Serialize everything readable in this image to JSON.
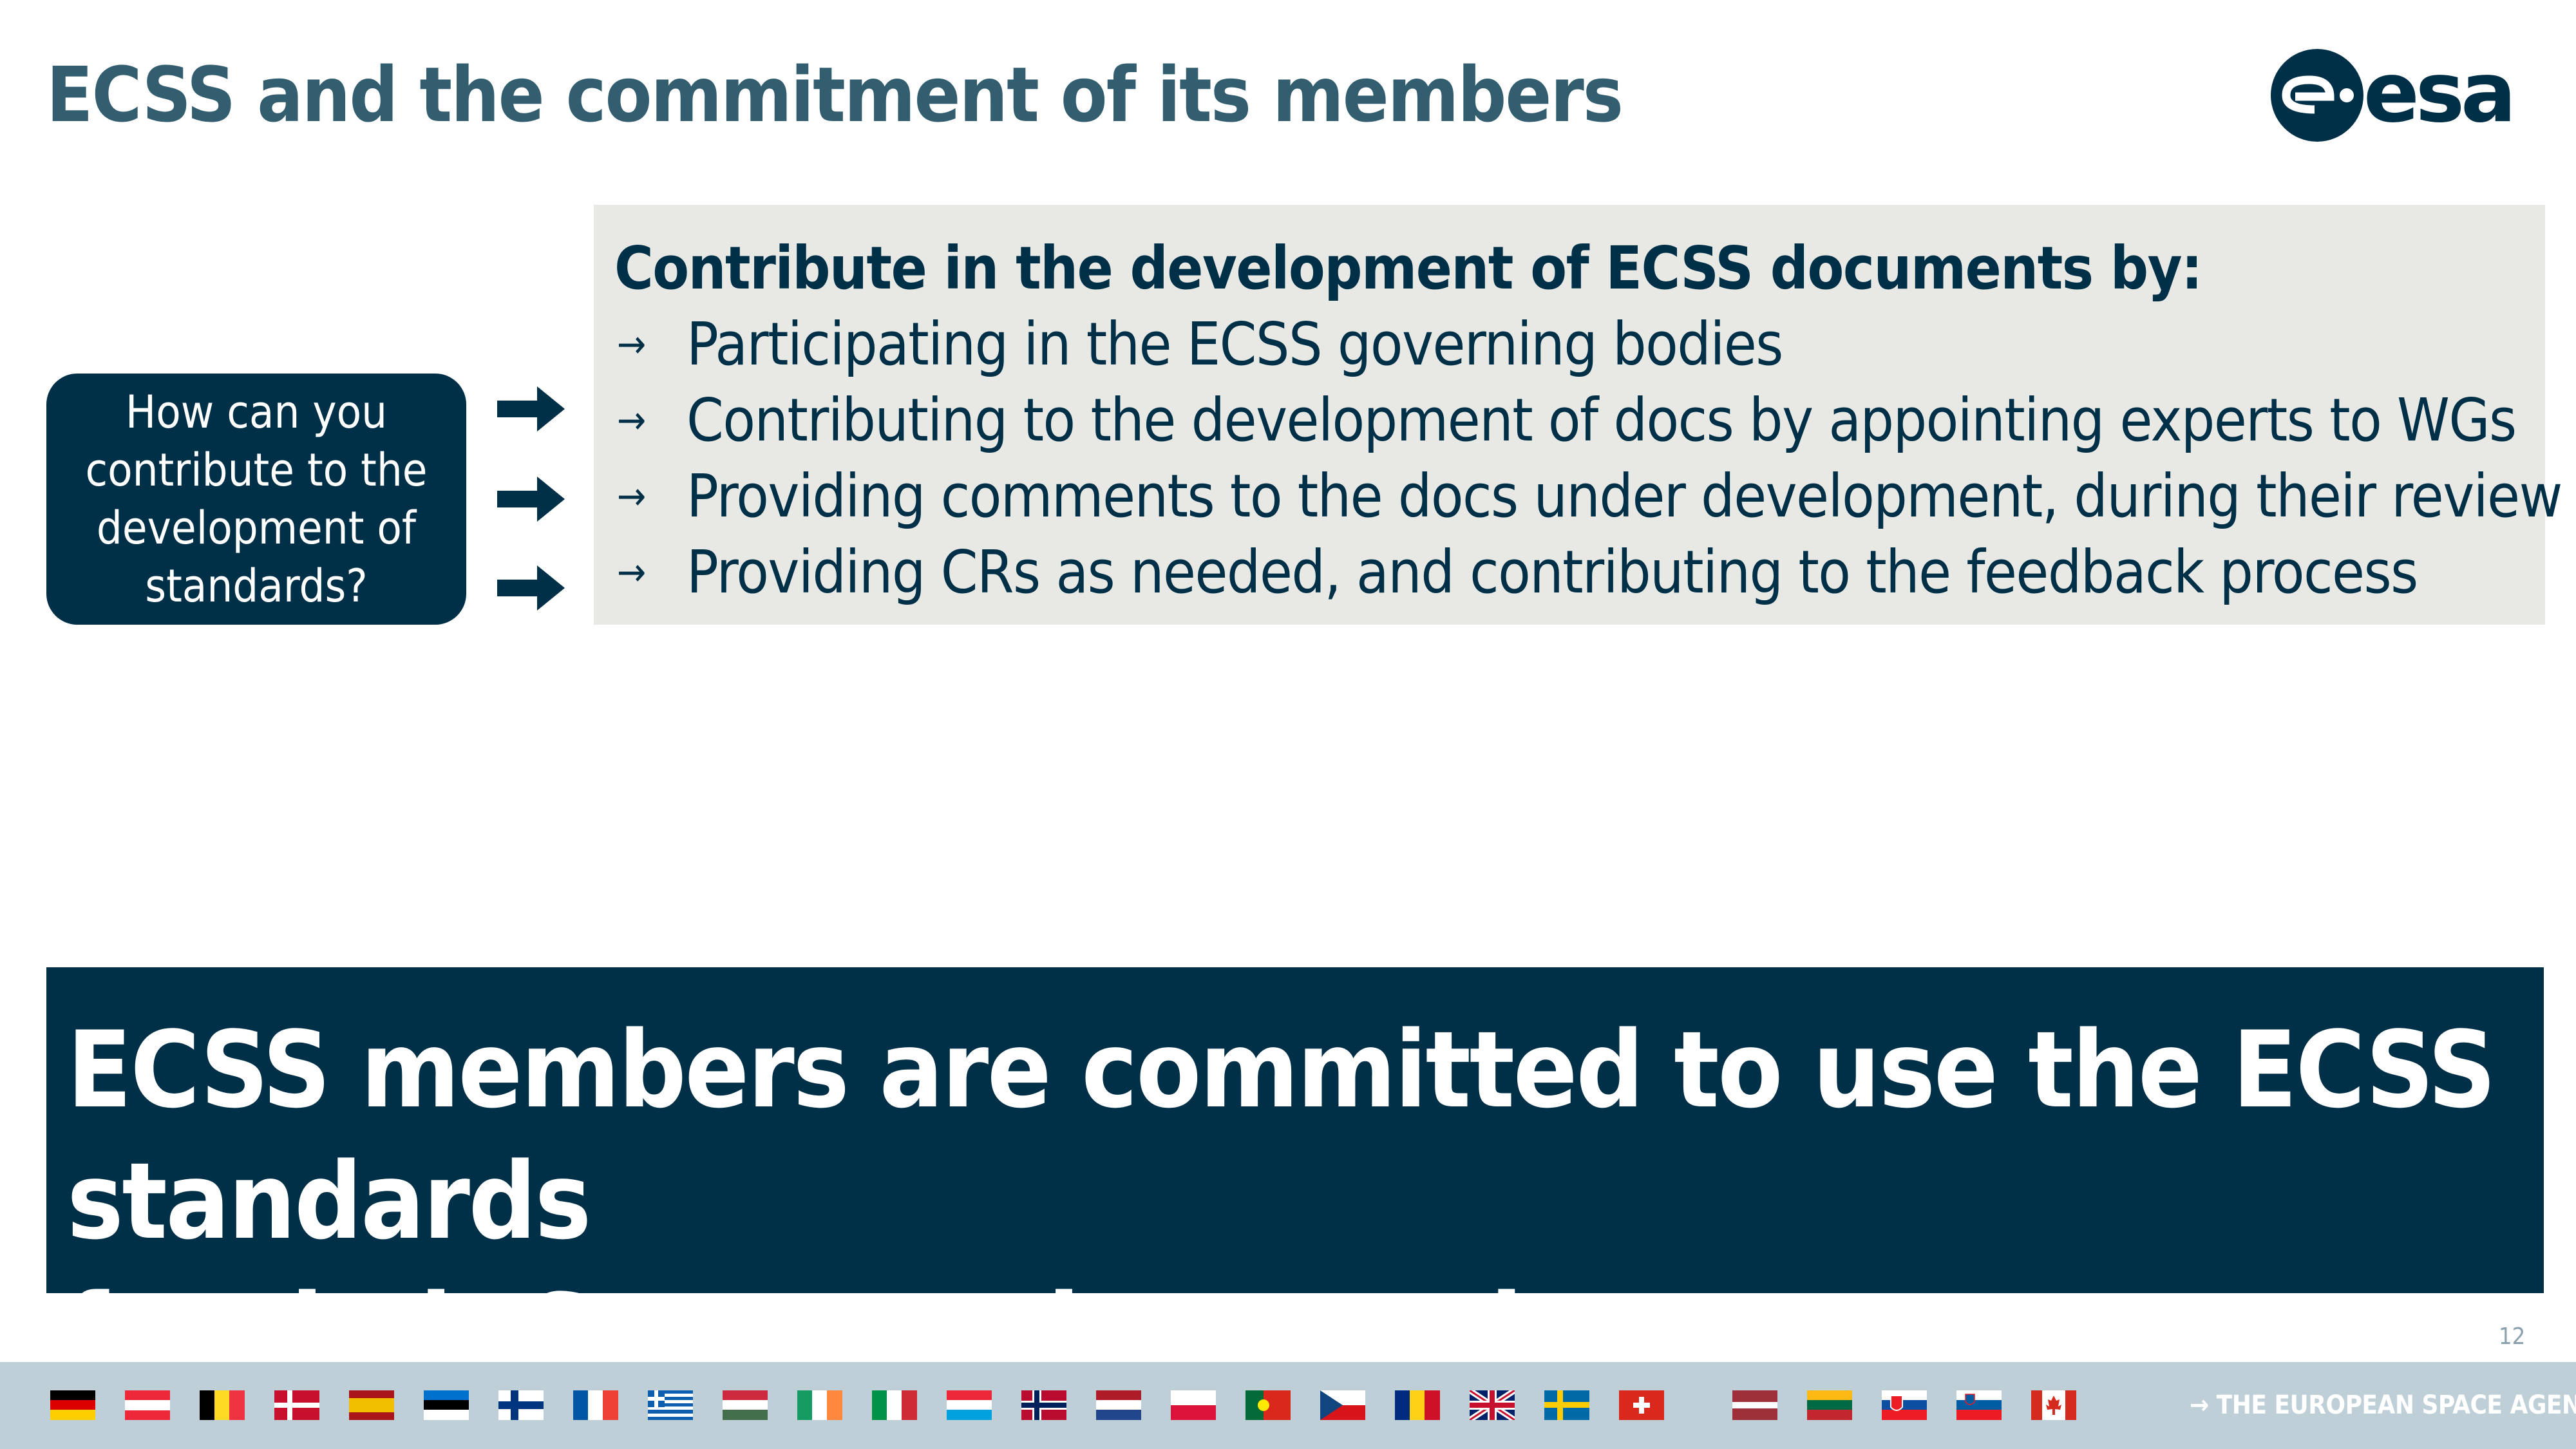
{
  "slide": {
    "title": "ECSS and the commitment of its members",
    "page_number": "12"
  },
  "logo": {
    "text": "esa"
  },
  "question": {
    "text": "How can you contribute to the development of standards?"
  },
  "info_panel": {
    "heading": "Contribute in the development of ECSS documents by:",
    "bullet_glyph": "→",
    "items": [
      "Participating in the ECSS governing bodies",
      "Contributing to the development of docs by appointing experts to WGs",
      "Providing comments to the docs under development, during their review",
      "Providing CRs as needed, and contributing to the feedback process"
    ]
  },
  "banner": {
    "line1": "ECSS members are committed to use the ECSS standards",
    "line2": "for their Space projects and programmes"
  },
  "footer": {
    "agency_text": "→ THE EUROPEAN SPACE AGENCY",
    "flags": [
      "germany-flag-icon",
      "austria-flag-icon",
      "belgium-flag-icon",
      "denmark-flag-icon",
      "spain-flag-icon",
      "estonia-flag-icon",
      "finland-flag-icon",
      "france-flag-icon",
      "greece-flag-icon",
      "hungary-flag-icon",
      "ireland-flag-icon",
      "italy-flag-icon",
      "luxembourg-flag-icon",
      "norway-flag-icon",
      "netherlands-flag-icon",
      "poland-flag-icon",
      "portugal-flag-icon",
      "czechia-flag-icon",
      "romania-flag-icon",
      "uk-flag-icon",
      "sweden-flag-icon",
      "switzerland-flag-icon",
      "latvia-flag-icon",
      "lithuania-flag-icon",
      "slovakia-flag-icon",
      "slovenia-flag-icon",
      "canada-flag-icon"
    ]
  },
  "colors": {
    "navy": "#003047",
    "title": "#335e6f",
    "panel_bg": "#e8e8e4",
    "footer_bg": "#bfcfd7"
  }
}
